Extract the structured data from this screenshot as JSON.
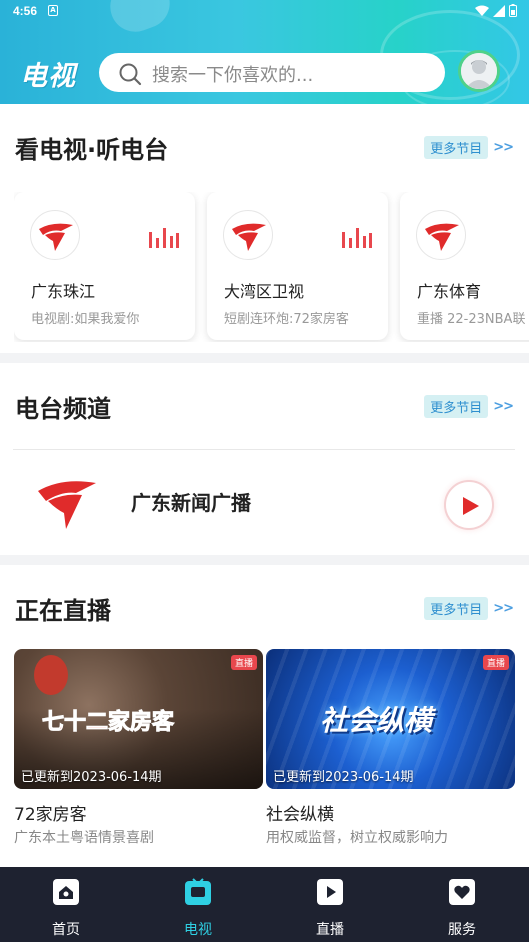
{
  "status_bar": {
    "time": "4:56",
    "sim_icon": "A"
  },
  "header": {
    "logo_text": "电视",
    "search_placeholder": "搜索一下你喜欢的...",
    "avatar": "user-avatar"
  },
  "tv_section": {
    "title": "看电视·听电台",
    "more_label": "更多节目",
    "more_arrow": ">>",
    "channels": [
      {
        "name": "广东珠江",
        "program": "电视剧:如果我爱你"
      },
      {
        "name": "大湾区卫视",
        "program": "短剧连环炮:72家房客"
      },
      {
        "name": "广东体育",
        "program": "重播 22-23NBA联"
      }
    ]
  },
  "radio_section": {
    "title": "电台频道",
    "more_label": "更多节目",
    "more_arrow": ">>",
    "station": {
      "name": "广东新闻广播"
    }
  },
  "live_section": {
    "title": "正在直播",
    "more_label": "更多节目",
    "more_arrow": ">>",
    "items": [
      {
        "tag": "直播",
        "updated": "已更新到2023-06-14期",
        "name": "72家房客",
        "desc": "广东本土粤语情景喜剧",
        "thumb_title": "七十二家房客"
      },
      {
        "tag": "直播",
        "updated": "已更新到2023-06-14期",
        "name": "社会纵横",
        "desc": "用权威监督，树立权威影响力",
        "thumb_title": "社会纵横"
      }
    ]
  },
  "bottom_nav": [
    {
      "label": "首页",
      "icon": "home-icon",
      "active": false
    },
    {
      "label": "电视",
      "icon": "tv-icon",
      "active": true
    },
    {
      "label": "直播",
      "icon": "live-play-icon",
      "active": false
    },
    {
      "label": "服务",
      "icon": "heart-service-icon",
      "active": false
    }
  ],
  "colors": {
    "accent": "#2fd0e3",
    "brand_red": "#e02b2b",
    "nav_bg": "#1e2230"
  }
}
